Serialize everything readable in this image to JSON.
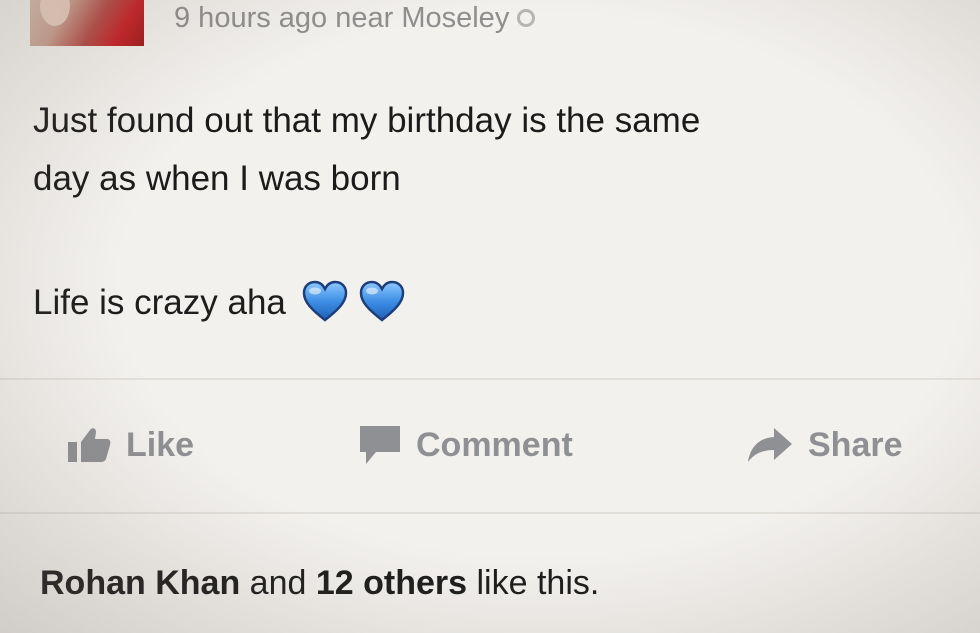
{
  "header": {
    "timestamp": "9 hours ago near Moseley",
    "icons": {
      "privacy": "globe-icon"
    }
  },
  "post": {
    "text_line1": "Just found out that my birthday is the same",
    "text_line2": "day as when I was born",
    "text_line3": "Life is crazy aha",
    "emoji": [
      "blue-heart",
      "blue-heart"
    ]
  },
  "actions": {
    "like_label": "Like",
    "comment_label": "Comment",
    "share_label": "Share",
    "icons": [
      "thumbs-up-icon",
      "comment-bubble-icon",
      "share-arrow-icon"
    ]
  },
  "likes": {
    "name": "Rohan Khan",
    "and": "and",
    "count_text": "12 others",
    "suffix": "like this."
  },
  "colors": {
    "background": "#f3f1ee",
    "action_gray": "#8f9093",
    "heart_blue": "#3f8fe6"
  }
}
